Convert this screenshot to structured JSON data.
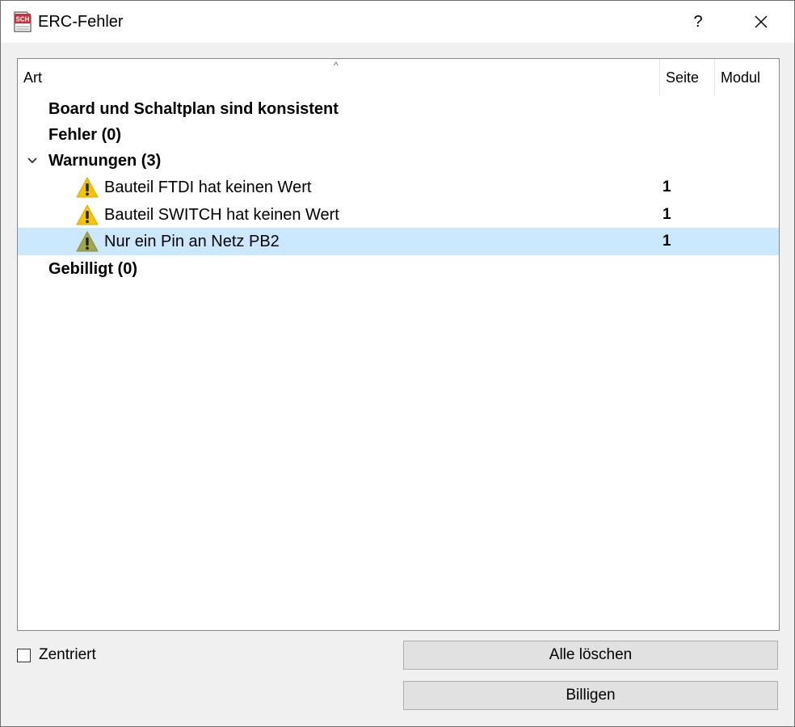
{
  "window": {
    "title": "ERC-Fehler",
    "help_label": "?",
    "app_icon_text": "SCH"
  },
  "columns": {
    "art": "Art",
    "seite": "Seite",
    "modul": "Modul"
  },
  "tree": {
    "consistent": "Board und Schaltplan sind konsistent",
    "errors": "Fehler (0)",
    "warnings": "Warnungen (3)",
    "warning_items": [
      {
        "label": "Bauteil FTDI hat keinen Wert",
        "page": "1"
      },
      {
        "label": "Bauteil SWITCH hat keinen Wert",
        "page": "1"
      },
      {
        "label": "Nur ein Pin an Netz PB2",
        "page": "1"
      }
    ],
    "approved": "Gebilligt (0)"
  },
  "controls": {
    "center_label": "Zentriert",
    "center_checked": false,
    "clear_all_label": "Alle löschen",
    "approve_label": "Billigen"
  },
  "colors": {
    "selection": "#cce8ff",
    "warning": "#f5c400",
    "warning_dim": "#a3a64a"
  },
  "icons": {
    "app": "sch-file-icon",
    "warning": "warning-icon",
    "expand": "chevron-down-icon",
    "close": "close-icon"
  }
}
